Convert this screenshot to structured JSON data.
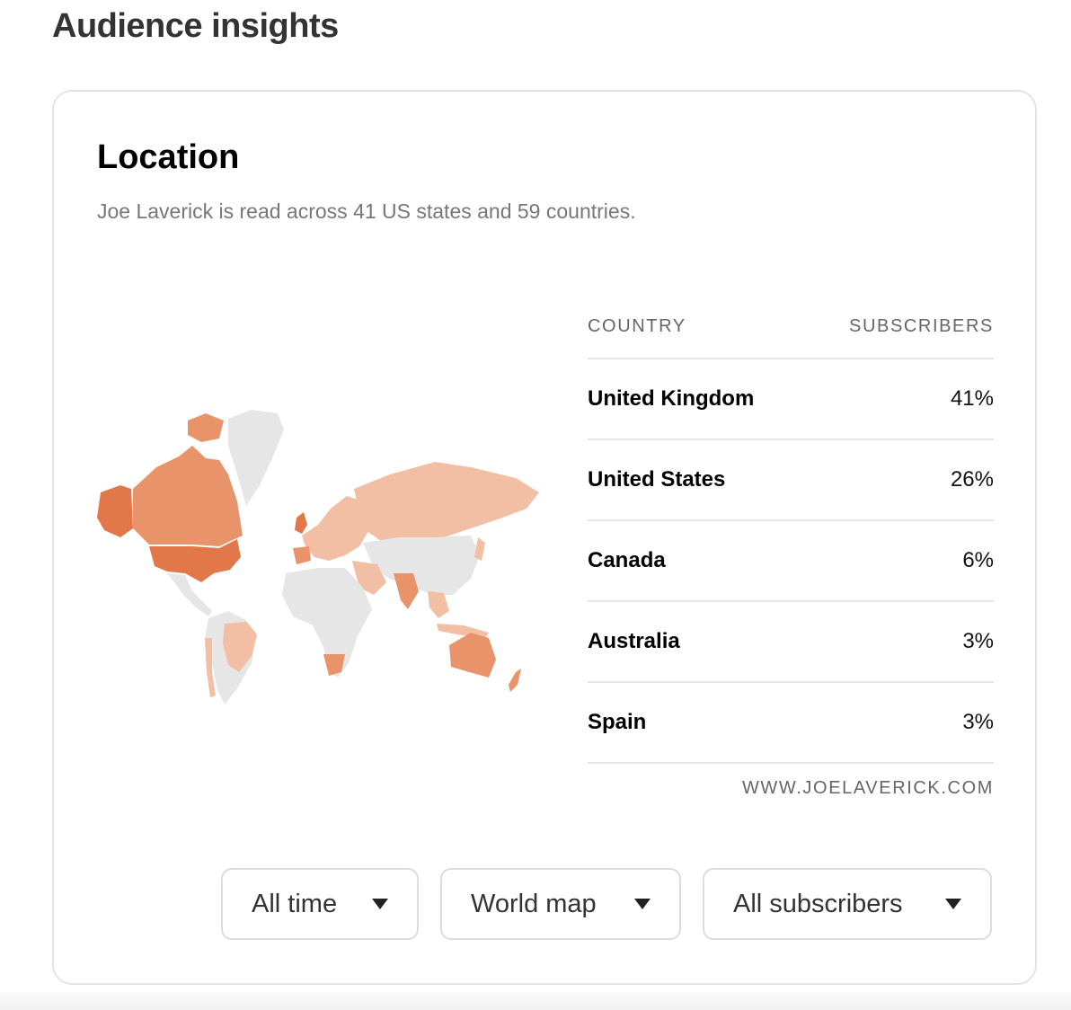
{
  "page": {
    "title": "Audience insights"
  },
  "location": {
    "title": "Location",
    "subtitle": "Joe Laverick is read across 41 US states and 59 countries."
  },
  "table": {
    "col_country": "COUNTRY",
    "col_subscribers": "SUBSCRIBERS",
    "rows": [
      {
        "country": "United Kingdom",
        "value": "41%"
      },
      {
        "country": "United States",
        "value": "26%"
      },
      {
        "country": "Canada",
        "value": "6%"
      },
      {
        "country": "Australia",
        "value": "3%"
      },
      {
        "country": "Spain",
        "value": "3%"
      }
    ],
    "source": "WWW.JOELAVERICK.COM"
  },
  "filters": {
    "time": "All time",
    "view": "World map",
    "audience": "All subscribers"
  },
  "colors": {
    "strong": "#e2784a",
    "medium": "#e9936b",
    "light": "#f2bea4",
    "none": "#e6e6e6"
  }
}
